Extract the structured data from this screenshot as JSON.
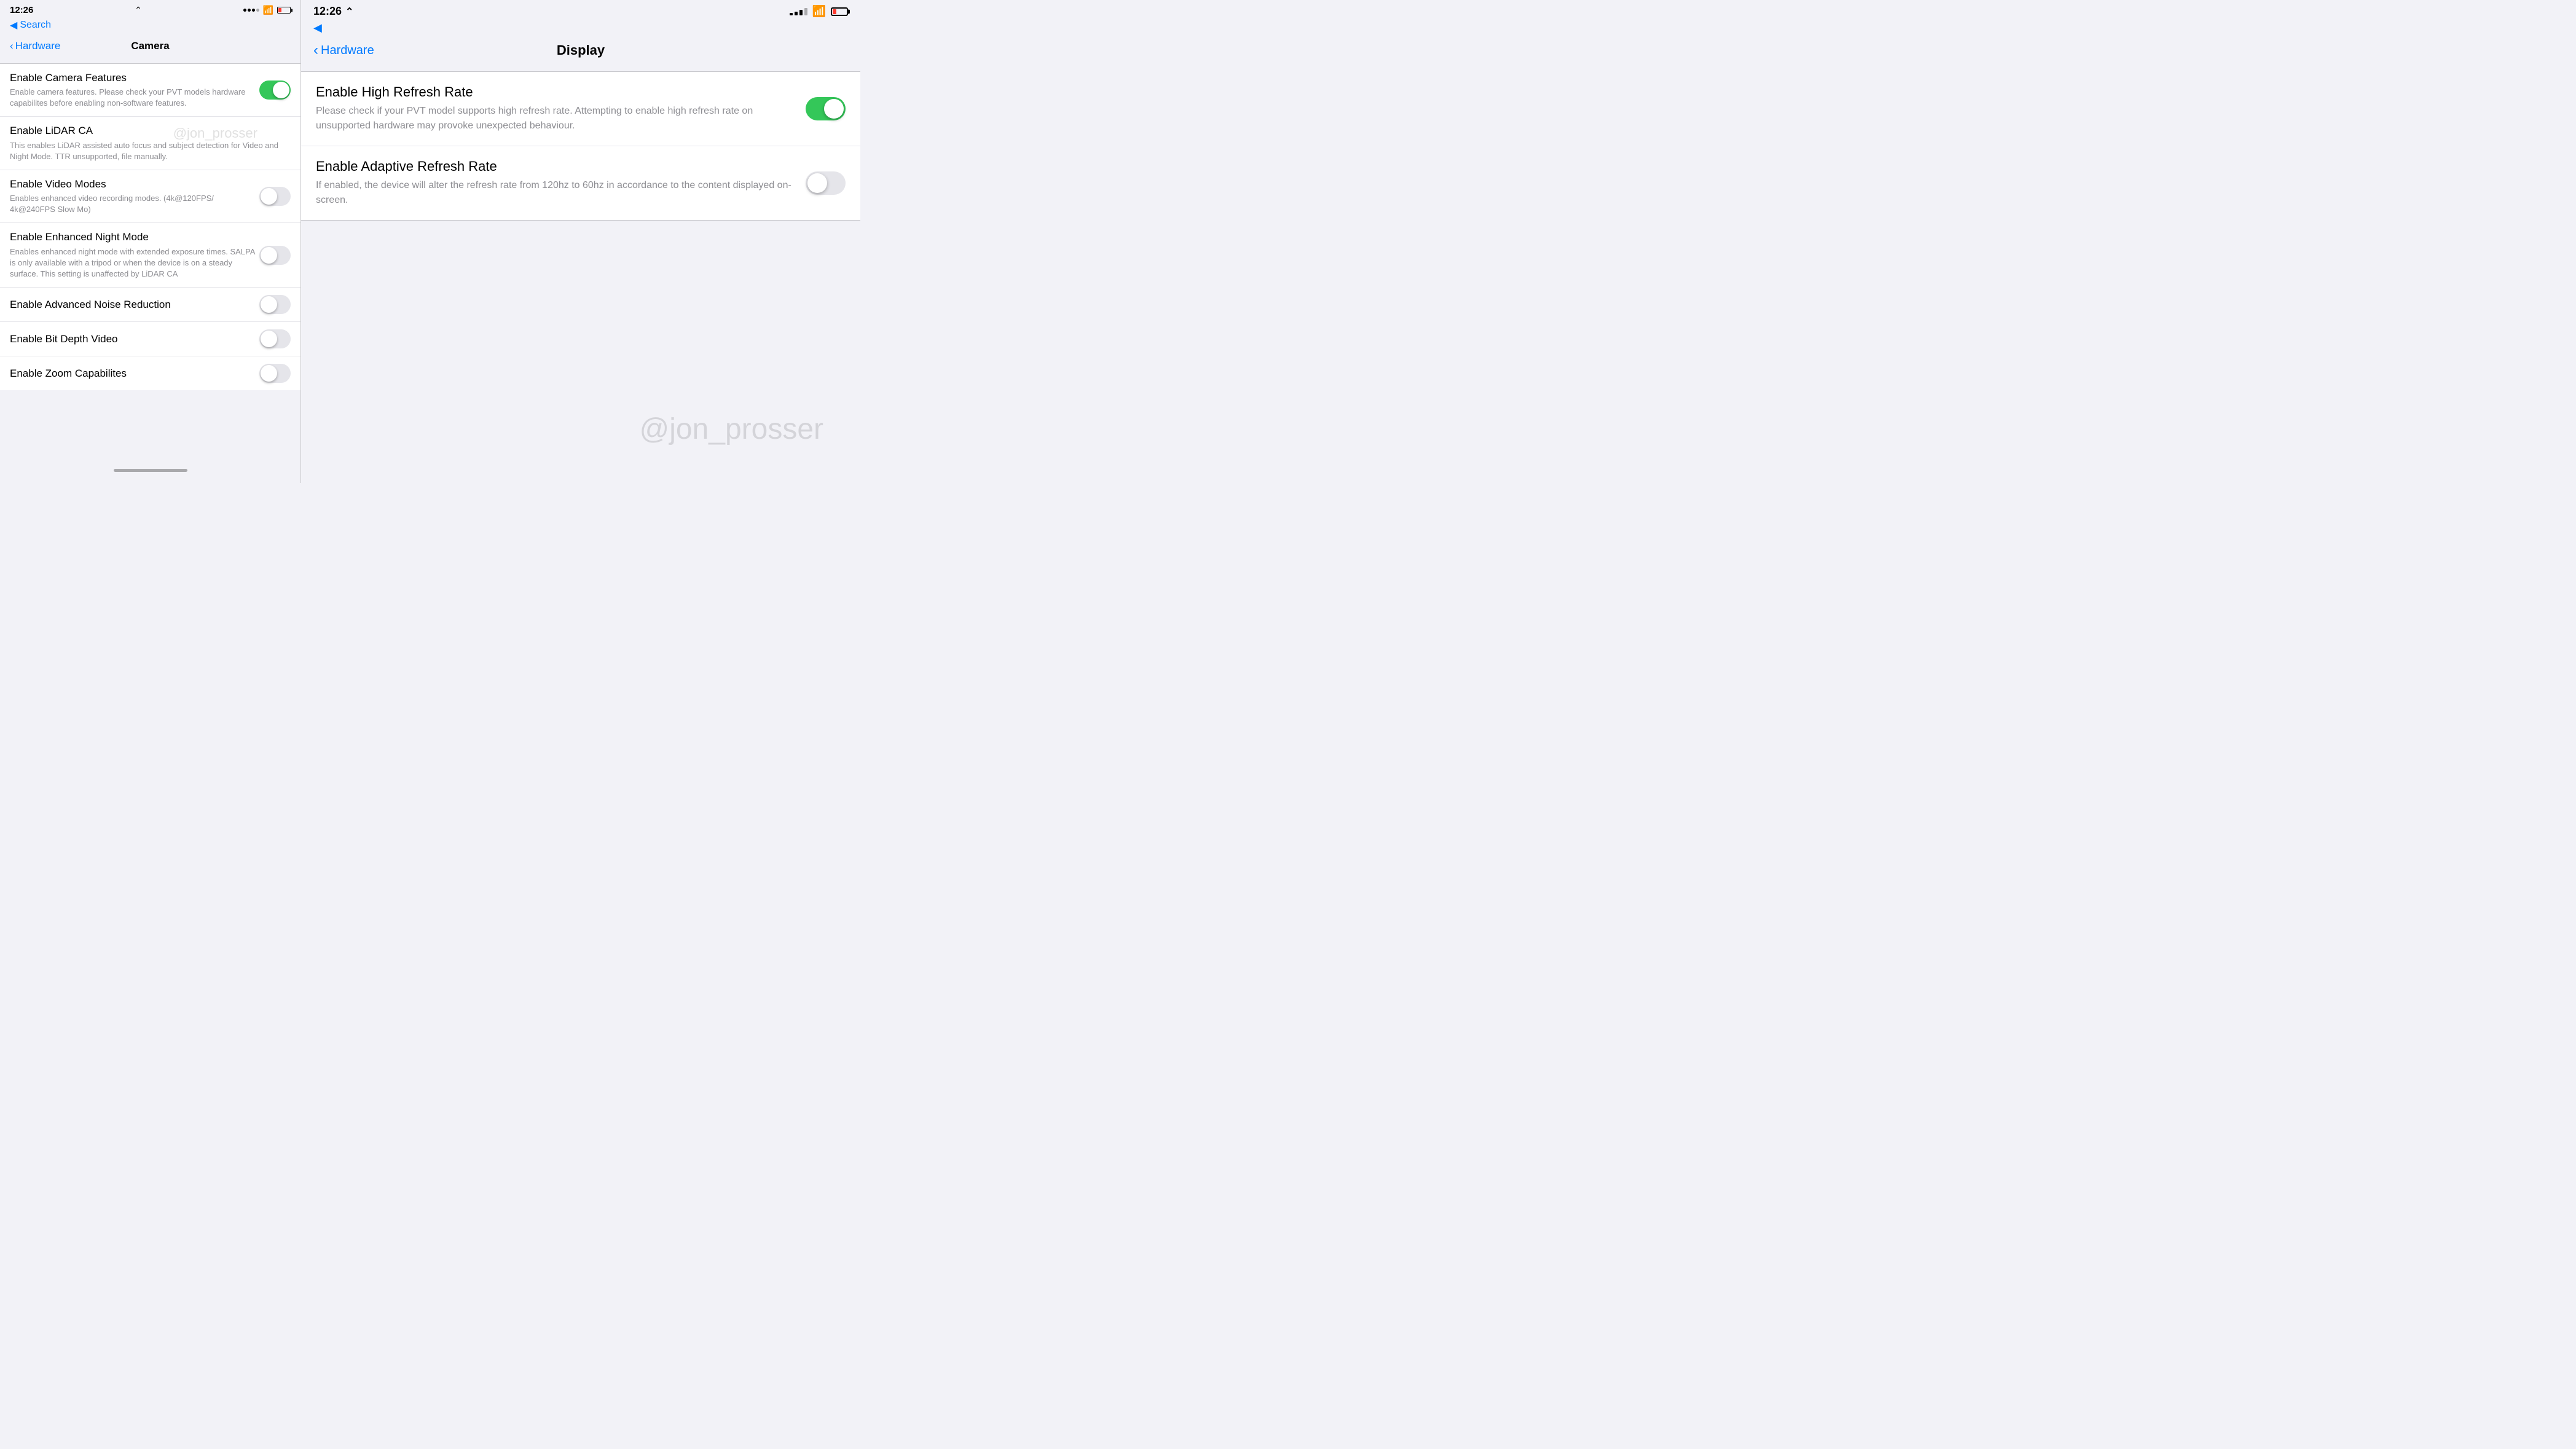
{
  "left": {
    "statusBar": {
      "time": "12:26",
      "locationIcon": "◂",
      "backLabel": "Search"
    },
    "nav": {
      "backLabel": "Hardware",
      "title": "Camera"
    },
    "settings": [
      {
        "label": "Enable Camera Features",
        "description": "Enable camera features. Please check your PVT models hardware capabilites before enabling non-software features.",
        "toggleOn": true
      },
      {
        "label": "Enable LiDAR CA",
        "description": "This enables LiDAR assisted auto focus and subject detection for Video and Night Mode. TTR unsupported, file manually.",
        "toggleOn": false,
        "watermark": true
      },
      {
        "label": "Enable Video Modes",
        "description": "Enables enhanced video recording modes. (4k@120FPS/ 4k@240FPS Slow Mo)",
        "toggleOn": false
      },
      {
        "label": "Enable Enhanced Night Mode",
        "description": "Enables enhanced night mode with extended exposure times. SALPA is only available with a tripod or when the device is on a steady surface. This setting is unaffected by LiDAR CA",
        "toggleOn": false
      },
      {
        "label": "Enable Advanced Noise Reduction",
        "description": "",
        "toggleOn": false
      },
      {
        "label": "Enable Bit Depth Video",
        "description": "",
        "toggleOn": false
      },
      {
        "label": "Enable Zoom Capabilites",
        "description": "",
        "toggleOn": false
      }
    ],
    "watermarkText": "@jon_prosser"
  },
  "right": {
    "statusBar": {
      "time": "12:26",
      "locationIcon": "◂"
    },
    "nav": {
      "backLabel": "Hardware",
      "title": "Display"
    },
    "settings": [
      {
        "label": "Enable High Refresh Rate",
        "description": "Please check if your PVT model supports high refresh rate. Attempting to enable high refresh rate on unsupported hardware may provoke unexpected behaviour.",
        "toggleOn": true
      },
      {
        "label": "Enable Adaptive Refresh Rate",
        "description": "If enabled, the device will alter the refresh rate from 120hz to 60hz in accordance to the content displayed on-screen.",
        "toggleOn": false
      }
    ],
    "watermarkText": "@jon_prosser"
  }
}
